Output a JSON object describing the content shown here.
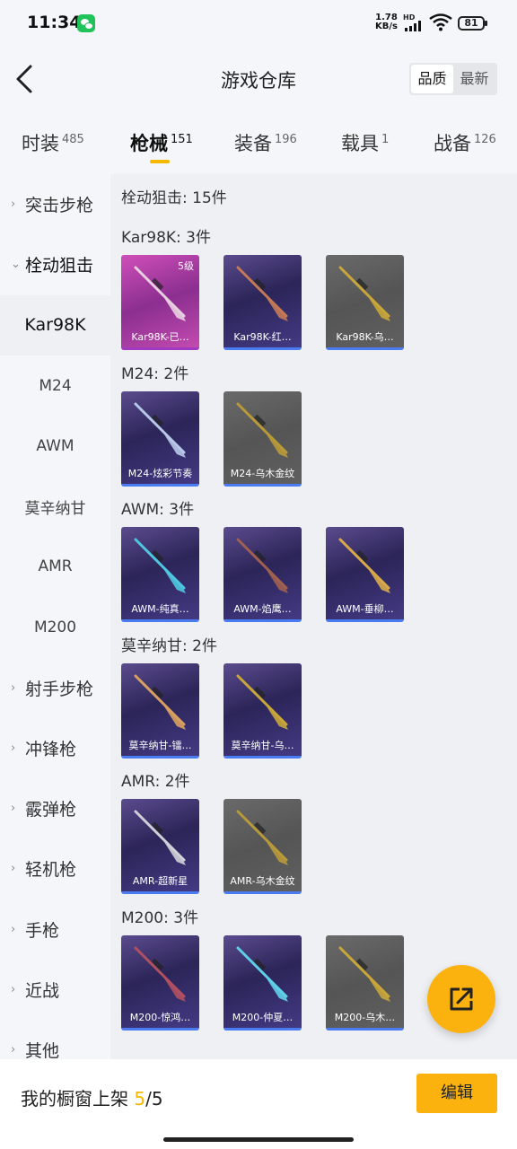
{
  "status_bar": {
    "time": "11:34",
    "net_speed_value": "1.78",
    "net_speed_unit": "KB/s",
    "network_label": "HD",
    "battery": "81"
  },
  "header": {
    "title": "游戏仓库",
    "sort_options": [
      "品质",
      "最新"
    ],
    "active_sort": "品质",
    "back_icon": "chevron-left-icon"
  },
  "categories": [
    {
      "label": "时装",
      "count": "485"
    },
    {
      "label": "枪械",
      "count": "151"
    },
    {
      "label": "装备",
      "count": "196"
    },
    {
      "label": "载具",
      "count": "1"
    },
    {
      "label": "战备",
      "count": "126"
    }
  ],
  "active_category": "枪械",
  "sidebar": {
    "items": [
      {
        "label": "突击步枪",
        "type": "parent"
      },
      {
        "label": "栓动狙击",
        "type": "parent-expanded"
      },
      {
        "label": "Kar98K",
        "type": "child-selected"
      },
      {
        "label": "M24",
        "type": "child"
      },
      {
        "label": "AWM",
        "type": "child"
      },
      {
        "label": "莫辛纳甘",
        "type": "child"
      },
      {
        "label": "AMR",
        "type": "child"
      },
      {
        "label": "M200",
        "type": "child"
      },
      {
        "label": "射手步枪",
        "type": "parent"
      },
      {
        "label": "冲锋枪",
        "type": "parent"
      },
      {
        "label": "霰弹枪",
        "type": "parent"
      },
      {
        "label": "轻机枪",
        "type": "parent"
      },
      {
        "label": "手枪",
        "type": "parent"
      },
      {
        "label": "近战",
        "type": "parent"
      },
      {
        "label": "其他",
        "type": "parent"
      }
    ]
  },
  "content": {
    "title": "栓动狙击: 15件",
    "groups": [
      {
        "label": "Kar98K: 3件",
        "items": [
          {
            "name": "Kar98K-已…",
            "style": "pink",
            "level": "5级",
            "gun_color": "#e8d0e0"
          },
          {
            "name": "Kar98K-红…",
            "style": "purple",
            "gun_color": "#c47a55"
          },
          {
            "name": "Kar98K-乌…",
            "style": "grey",
            "gun_color": "#c9a63a"
          }
        ]
      },
      {
        "label": "M24: 2件",
        "items": [
          {
            "name": "M24-炫彩节奏",
            "style": "purple",
            "gun_color": "#b8c8e8"
          },
          {
            "name": "M24-乌木金纹",
            "style": "grey",
            "gun_color": "#b89a3a"
          }
        ]
      },
      {
        "label": "AWM: 3件",
        "items": [
          {
            "name": "AWM-纯真…",
            "style": "purple",
            "gun_color": "#4fc6e0"
          },
          {
            "name": "AWM-焰鹰…",
            "style": "purple",
            "gun_color": "#a06050"
          },
          {
            "name": "AWM-垂柳…",
            "style": "purple",
            "gun_color": "#d8a84a"
          }
        ]
      },
      {
        "label": "莫辛纳甘: 2件",
        "items": [
          {
            "name": "莫辛纳甘-镭…",
            "style": "purple",
            "gun_color": "#d8a060"
          },
          {
            "name": "莫辛纳甘-乌…",
            "style": "purple",
            "gun_color": "#c9a63a"
          }
        ]
      },
      {
        "label": "AMR: 2件",
        "items": [
          {
            "name": "AMR-超新星",
            "style": "purple",
            "gun_color": "#d0d0d8"
          },
          {
            "name": "AMR-乌木金纹",
            "style": "grey",
            "gun_color": "#b89a3a"
          }
        ]
      },
      {
        "label": "M200: 3件",
        "items": [
          {
            "name": "M200-惊鸿…",
            "style": "purple",
            "gun_color": "#b05060"
          },
          {
            "name": "M200-仲夏…",
            "style": "purple",
            "gun_color": "#5fd0e8"
          },
          {
            "name": "M200-乌木…",
            "style": "grey",
            "gun_color": "#c9a63a"
          }
        ]
      }
    ]
  },
  "share_fab_icon": "share-external-icon",
  "bottom_bar": {
    "label": "我的橱窗上架 ",
    "count_current": "5",
    "count_total": "/5",
    "edit_label": "编辑"
  },
  "colors": {
    "accent": "#fbb20f",
    "tab_underline": "#f5b800",
    "card_underline": "#4a7bf0"
  }
}
